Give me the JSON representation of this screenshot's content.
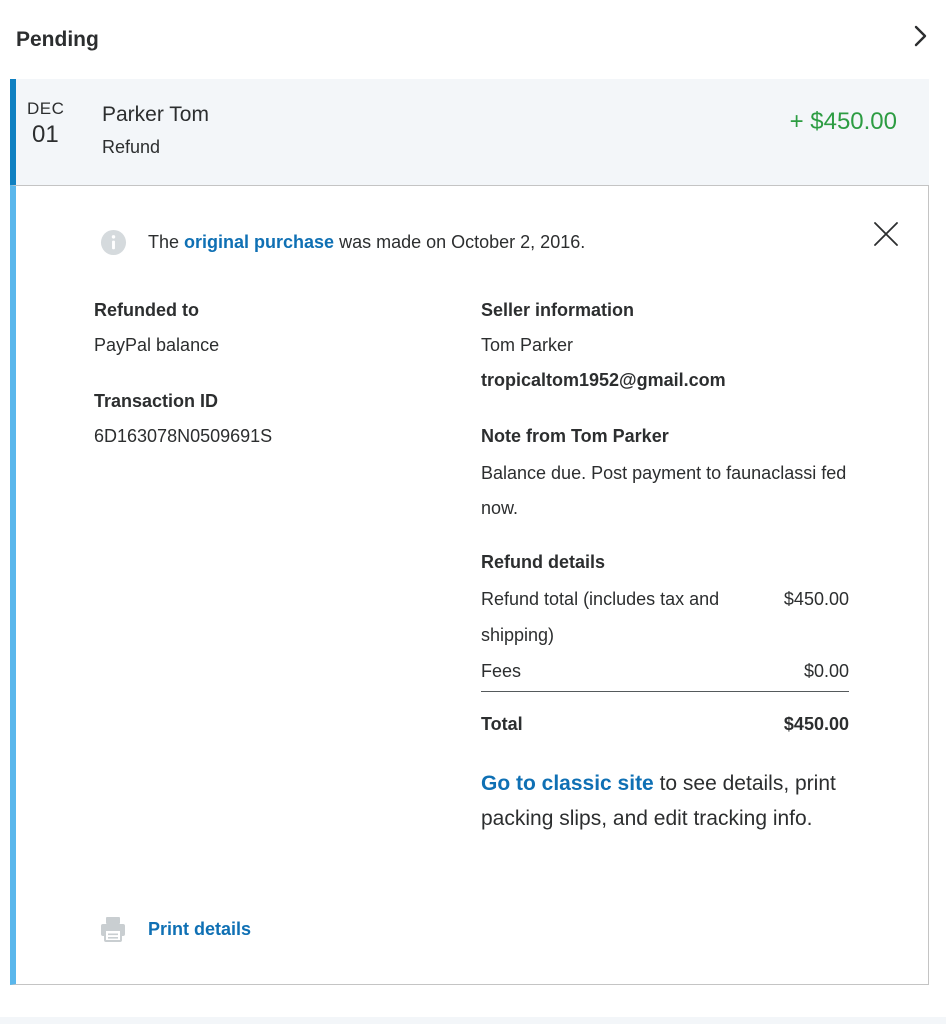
{
  "header": {
    "title": "Pending"
  },
  "transaction": {
    "month": "DEC",
    "day": "01",
    "name": "Parker Tom",
    "type": "Refund",
    "amount": "+ $450.00"
  },
  "info": {
    "prefix": "The ",
    "link": "original purchase",
    "suffix": " was made on October 2, 2016."
  },
  "left": {
    "refunded_to_label": "Refunded to",
    "refunded_to_value": "PayPal balance",
    "transaction_id_label": "Transaction ID",
    "transaction_id_value": "6D163078N0509691S"
  },
  "seller": {
    "label": "Seller information",
    "name": "Tom Parker",
    "email": "tropicaltom1952@gmail.com"
  },
  "note": {
    "label": "Note from Tom Parker",
    "text": "Balance due. Post payment to faunaclassi fed now."
  },
  "refund_details": {
    "label": "Refund details",
    "total_label": "Refund total (includes tax and shipping)",
    "total_value": "$450.00",
    "fees_label": "Fees",
    "fees_value": "$0.00",
    "grand_total_label": "Total",
    "grand_total_value": "$450.00"
  },
  "classic": {
    "link": "Go to classic site",
    "text": " to see details, print packing slips, and edit tracking info."
  },
  "print": {
    "label": "Print details"
  },
  "colors": {
    "accent_blue": "#0f70b4",
    "positive_green": "#2c9c42",
    "selected_bar": "#0f80c1",
    "panel_bar": "#5ab7ec"
  }
}
